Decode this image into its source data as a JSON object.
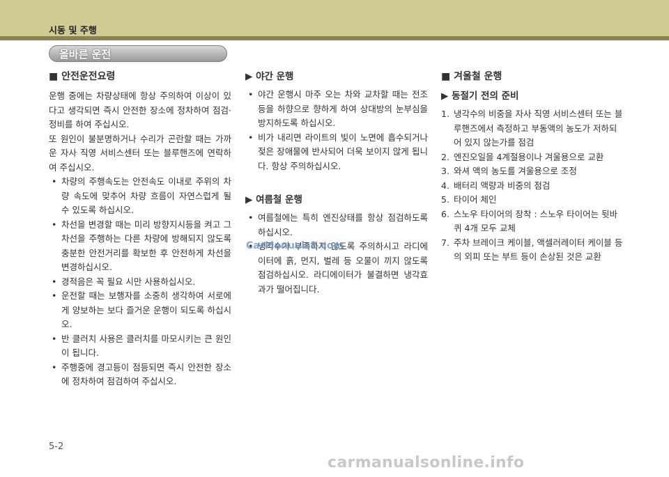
{
  "header": {
    "title": "시동 및 주행"
  },
  "section": {
    "title": "올바른 운전"
  },
  "col1": {
    "heading": "■ 안전운전요령",
    "para1": "운행 중에는 차량상태에 항상 주의하여 이상이 있다고 생각되면 즉시 안전한 장소에 정차하여 점검·정비를 하여 주십시오.",
    "para2": "또 원인이 불분명하거나 수리가 곤란할 때는 가까운 자사 직영 서비스센터 또는 블루핸즈에 연락하여 주십시오.",
    "bullets": [
      "차량의 주행속도는 안전속도 이내로 주위의 차량 속도에 맞추어 차량 흐름이 자연스럽게 될 수 있도록 하십시오.",
      "차선을 변경할 때는 미리 방향지시등을 켜고 그 차선을 주행하는 다른 차량에 방해되지 않도록 충분한 안전거리를 확보한 후 안전하게 차선을 변경하십시오.",
      "경적음은 꼭 필요 시만 사용하십시오.",
      "운전할 때는 보행자를 소중히 생각하여 서로에게 양보하는 보다 즐거운 운행이 되도록 하십시오.",
      "반 클러치 사용은 클러치를 마모시키는 큰 원인이 됩니다.",
      "주행중에 경고등이 점등되면 즉시 안전한 장소에 정차하여 점검하여 주십시오."
    ]
  },
  "col2": {
    "night_heading": "▶ 야간 운행",
    "night_bullets": [
      "야간 운행시 마주 오는 차와 교차할 때는 전조등을 하향으로 향하게 하여 상대방의 눈부심을 방지하도록 하십시오.",
      "비가 내리면 라이트의 빛이 노면에 흡수되거나 젖은 장애물에 반사되어 더욱 보이지 않게 됩니다. 항상 주의하십시오."
    ],
    "summer_heading": "▶ 여름철 운행",
    "summer_bullets": [
      "여름철에는 특히 엔진상태를 항상 점검하도록 하십시오.",
      "냉각수가 부족하지 않도록 주의하시고 라디에이터에 흙, 먼지, 벌레 등 오물이 끼지 않도록 점검하십시오. 라디에이터가 불결하면 냉각효과가 떨어집니다."
    ]
  },
  "col3": {
    "heading": "■ 겨울철 운행",
    "subheading": "▶ 동절기 전의 준비",
    "items": [
      {
        "num": "1.",
        "text": "냉각수의 비중을 자사 직영 서비스센터 또는 블루핸즈에서 측정하고 부동액의 농도가 저하되어 있지 않는가를 점검"
      },
      {
        "num": "2.",
        "text": "엔진오일을 4계절용이나 겨울용으로 교환"
      },
      {
        "num": "3.",
        "text": "와셔 액의 농도를 겨울용으로 조정"
      },
      {
        "num": "4.",
        "text": "배터리 액량과 비중의 점검"
      },
      {
        "num": "5.",
        "text": "타이어 체인"
      },
      {
        "num": "6.",
        "text": "스노우 타이어의 장착 : 스노우 타이어는 뒷바퀴 4개 모두 교체"
      },
      {
        "num": "7.",
        "text": "주차 브레이크 케이블, 액셀러레이터 케이블 등의 외피 또는 부트 등이 손상된 것은 교환"
      }
    ]
  },
  "footer": {
    "page": "5-2"
  },
  "watermarks": {
    "mid": "CarManuals2.com",
    "bottom": "carmanualsonline.info"
  }
}
